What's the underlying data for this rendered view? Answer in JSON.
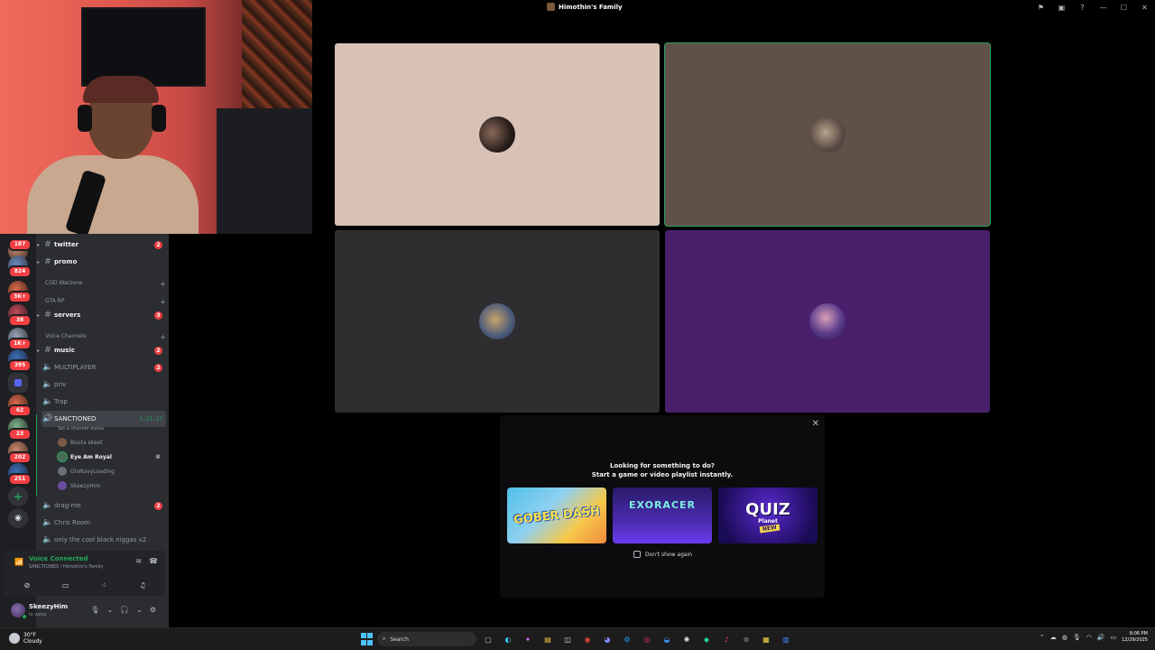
{
  "window": {
    "title": "Himothin's Family",
    "icons": [
      "flag-icon",
      "inbox-icon",
      "help-icon"
    ],
    "controls": [
      "minimize-icon",
      "maximize-icon",
      "close-icon"
    ]
  },
  "servers": [
    {
      "name": "server-1",
      "badge": "187"
    },
    {
      "name": "server-2",
      "badge": "824"
    },
    {
      "name": "server-3",
      "badge": "3K+"
    },
    {
      "name": "server-4",
      "badge": "38"
    },
    {
      "name": "server-5",
      "badge": "1K+"
    },
    {
      "name": "server-6",
      "badge": "395"
    },
    {
      "name": "server-7",
      "badge": "62"
    },
    {
      "name": "server-8",
      "badge": "23"
    },
    {
      "name": "server-9",
      "badge": "202"
    },
    {
      "name": "server-10",
      "badge": "251"
    }
  ],
  "channels": {
    "twitter": {
      "label": "twitter",
      "count": "2"
    },
    "promo": {
      "label": "promo"
    },
    "cat_cod": "COD Warzone",
    "cat_gta": "GTA RP",
    "servers": {
      "label": "servers",
      "count": "3"
    },
    "cat_voice": "Voice Channels",
    "music": {
      "label": "music",
      "count": "2"
    },
    "multiplayer": {
      "label": "MULTIPLAYER",
      "count": "2"
    },
    "priv": {
      "label": "priv"
    },
    "trap": {
      "label": "Trap"
    },
    "sanctioned": {
      "label": "SANCTIONED",
      "timer": "1:21:17",
      "status": "Set a channel status"
    },
    "voice_users": [
      "Bouta skeet",
      "Eye Am Royal",
      "GloNavyLoading",
      "SkeezyHim"
    ],
    "drag_me": {
      "label": "drag-me",
      "count": "2"
    },
    "chris_room": {
      "label": "Chris Room"
    },
    "cool": {
      "label": "only the cool black niggas v2"
    }
  },
  "voice": {
    "status": "Voice Connected",
    "location": "SANCTIONED / Himothin's Family"
  },
  "user": {
    "name": "SkeezyHim",
    "status": "In voice"
  },
  "tiles": [
    {
      "name": "participant-1",
      "bg": "#d8c2b6"
    },
    {
      "name": "participant-2",
      "bg": "#5f5048"
    },
    {
      "name": "participant-3",
      "bg": "#2e2e31"
    },
    {
      "name": "participant-4",
      "bg": "#4a1f6b"
    }
  ],
  "activity": {
    "line1": "Looking for something to do?",
    "line2": "Start a game or video playlist instantly.",
    "games": [
      {
        "name": "Gober Dash",
        "logo": "GOBER DASH"
      },
      {
        "name": "Exoracer",
        "logo": "EXORACER"
      },
      {
        "name": "Quiz Planet",
        "logo": "QUIZ",
        "sub": "Planet",
        "tag": "NEW"
      }
    ],
    "dont_show": "Don't show again"
  },
  "taskbar": {
    "temp": "30°F",
    "condition": "Cloudy",
    "search": "Search",
    "time": "8:06 PM",
    "date": "12/29/2025"
  }
}
